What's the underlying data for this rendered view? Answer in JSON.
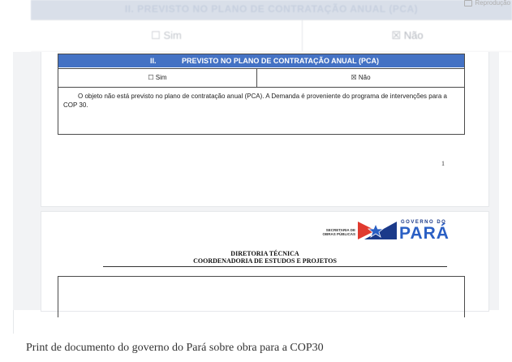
{
  "credit": "Reprodução",
  "background_table": {
    "header": "II.      PREVISTO NO PLANO DE CONTRATAÇÃO ANUAL (PCA)",
    "sim": "☐ Sim",
    "nao": "☒ Não"
  },
  "document": {
    "pca_section_number": "II.",
    "pca_section_title": "PREVISTO NO PLANO DE CONTRATAÇÃO ANUAL (PCA)",
    "option_sim": "☐ Sim",
    "option_nao": "☒ Não",
    "body_text": "O objeto não está previsto no plano de contratação anual (PCA). A Demanda é proveniente do programa de intervenções para a COP 30.",
    "page_number": "1",
    "secretaria_line1": "SECRETARIA DE",
    "secretaria_line2": "OBRAS PÚBLICAS",
    "governo_label": "GOVERNO DO",
    "para_label": "PARÁ",
    "diretoria": "DIRETORIA TÉCNICA",
    "coordenadoria": "COORDENADORIA DE ESTUDOS E PROJETOS"
  },
  "caption": "Print de documento do governo do Pará sobre obra para a COP30",
  "colors": {
    "header_blue": "#4472c4",
    "logo_red": "#e03a2f",
    "logo_blue": "#1b3a8a",
    "para_blue": "#2a5fc4"
  }
}
